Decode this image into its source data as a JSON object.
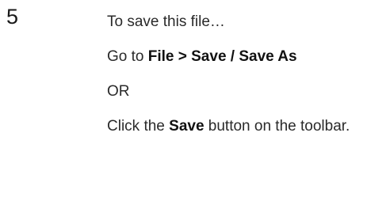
{
  "step": {
    "number": "5"
  },
  "instructions": {
    "intro": "To save this file…",
    "goto_prefix": "Go to ",
    "goto_path": "File > Save / Save As",
    "or": "OR",
    "click_prefix": "Click the ",
    "click_button_name": "Save",
    "click_suffix": " button on the toolbar."
  }
}
